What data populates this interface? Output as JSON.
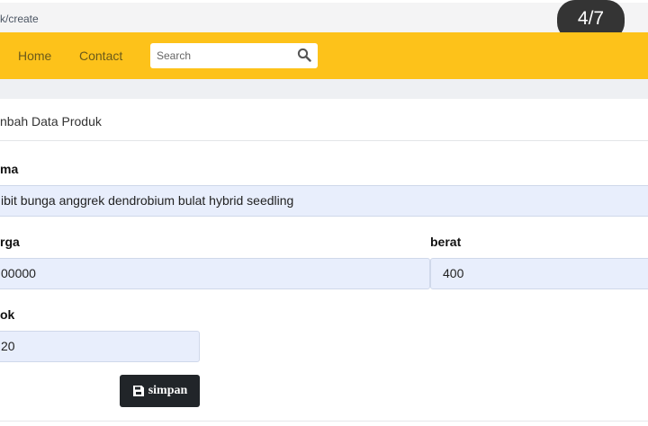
{
  "browser": {
    "url": "k/create"
  },
  "overlay": {
    "page_counter": "4/7"
  },
  "navbar": {
    "home_label": "Home",
    "contact_label": "Contact",
    "search_placeholder": "Search"
  },
  "form": {
    "title": "nbah Data Produk",
    "nama": {
      "label": "ma",
      "value": "ibit bunga anggrek dendrobium bulat hybrid seedling"
    },
    "harga": {
      "label": "rga",
      "value": "00000"
    },
    "berat": {
      "label": "berat",
      "value": "400"
    },
    "stok": {
      "label": "ok",
      "value": "20"
    },
    "save_label": "simpan"
  },
  "colors": {
    "navbar": "#fdc21a",
    "field_bg": "#e8eefc",
    "button_bg": "#212529"
  },
  "icons": {
    "search": "search-icon",
    "save": "save-icon"
  }
}
